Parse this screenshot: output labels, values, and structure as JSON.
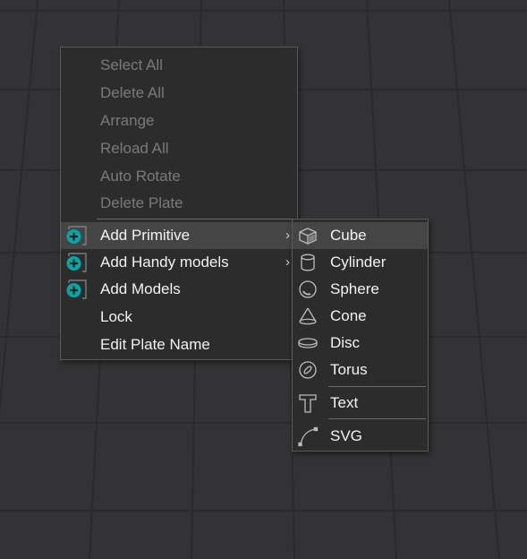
{
  "context_menu": {
    "items": [
      {
        "label": "Select All",
        "enabled": false
      },
      {
        "label": "Delete All",
        "enabled": false
      },
      {
        "label": "Arrange",
        "enabled": false
      },
      {
        "label": "Reload All",
        "enabled": false
      },
      {
        "label": "Auto Rotate",
        "enabled": false
      },
      {
        "label": "Delete Plate",
        "enabled": false
      },
      {
        "label": "Add Primitive",
        "icon": "add-plus-icon",
        "has_submenu": true,
        "highlighted": true
      },
      {
        "label": "Add Handy models",
        "icon": "add-plus-icon",
        "has_submenu": true
      },
      {
        "label": "Add Models",
        "icon": "add-plus-icon"
      },
      {
        "label": "Lock"
      },
      {
        "label": "Edit Plate Name"
      }
    ],
    "submenu_arrow": "›"
  },
  "primitive_submenu": {
    "items": [
      {
        "label": "Cube",
        "icon": "cube-icon",
        "highlighted": true
      },
      {
        "label": "Cylinder",
        "icon": "cylinder-icon"
      },
      {
        "label": "Sphere",
        "icon": "sphere-icon"
      },
      {
        "label": "Cone",
        "icon": "cone-icon"
      },
      {
        "label": "Disc",
        "icon": "disc-icon"
      },
      {
        "label": "Torus",
        "icon": "torus-icon"
      },
      {
        "label": "Text",
        "icon": "text-icon"
      },
      {
        "label": "SVG",
        "icon": "svg-curve-icon"
      }
    ]
  },
  "colors": {
    "accent": "#00a8a8",
    "menu_bg": "#2c2c2c",
    "highlight_bg": "#454545",
    "viewport_bg": "#333335"
  }
}
